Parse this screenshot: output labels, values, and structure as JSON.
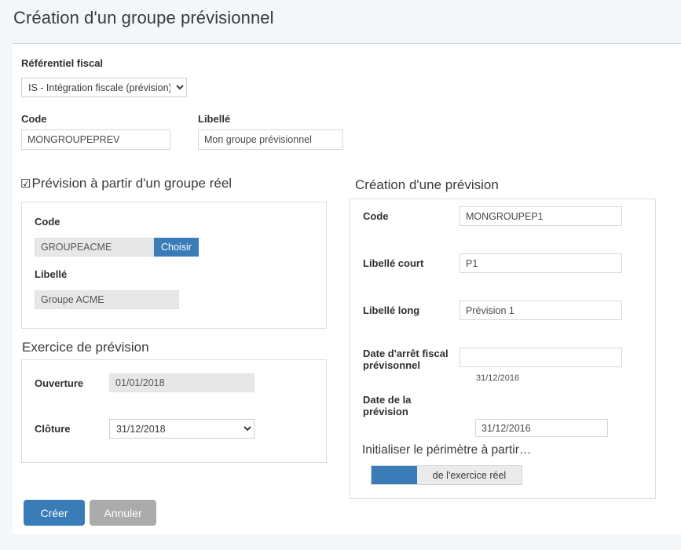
{
  "page": {
    "title": "Création d'un groupe prévisionnel"
  },
  "referentiel": {
    "label": "Référentiel fiscal",
    "selected": "IS - Intégration fiscale (prévision)",
    "options": [
      "IS - Intégration fiscale (prévision)"
    ],
    "caret": "chevron-down-icon"
  },
  "identity": {
    "code_label": "Code",
    "code_value": "MONGROUPEPREV",
    "libelle_label": "Libellé",
    "libelle_value": "Mon groupe prévisionnel"
  },
  "source_group": {
    "checkbox_glyph": "☑",
    "checked": true,
    "heading": "Prévision à partir d'un groupe réel",
    "code_label": "Code",
    "code_value": "GROUPEACME",
    "choose_button": "Choisir",
    "libelle_label": "Libellé",
    "libelle_value": "Groupe ACME"
  },
  "exercice": {
    "heading": "Exercice de prévision",
    "ouverture_label": "Ouverture",
    "ouverture_value": "01/01/2018",
    "cloture_label": "Clôture",
    "cloture_value": "31/12/2018",
    "cloture_options": [
      "31/12/2018"
    ]
  },
  "prevision": {
    "heading": "Création d'une prévision",
    "code_label": "Code",
    "code_value": "MONGROUPEP1",
    "libelle_court_label": "Libellé court",
    "libelle_court_value": "P1",
    "libelle_long_label": "Libellé long",
    "libelle_long_value": "Prévision 1",
    "date_arret_label": "Date d'arrêt fiscal prévisonnel",
    "date_arret_value": "",
    "date_arret_hint": "31/12/2016",
    "date_prevision_label": "Date de la prévision",
    "date_prevision_value": "31/12/2016",
    "perimetre_label": "Initialiser le périmètre à partir…",
    "perimetre_toggle_text": "de l'exercice réel",
    "perimetre_toggle_on": true
  },
  "actions": {
    "create": "Créer",
    "cancel": "Annuler"
  },
  "colors": {
    "accent": "#3a7cb8",
    "muted": "#ababab",
    "page_bg": "#f4f7fa",
    "panel_border": "#dcdcea"
  }
}
